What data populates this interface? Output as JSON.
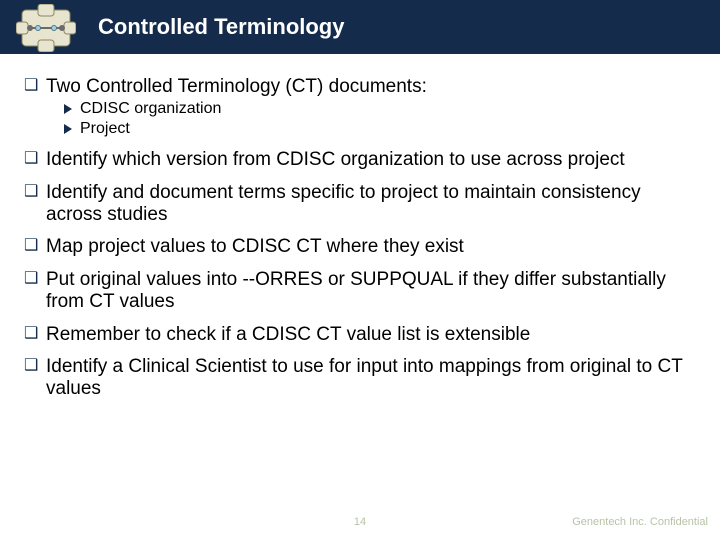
{
  "title": "Controlled Terminology",
  "bullets": [
    {
      "text": "Two Controlled Terminology (CT) documents:",
      "children": [
        {
          "text": "CDISC organization"
        },
        {
          "text": "Project"
        }
      ]
    },
    {
      "text": "Identify which version from CDISC organization to use across project"
    },
    {
      "text": "Identify and document terms specific to project to maintain consistency across studies"
    },
    {
      "text": "Map project values to CDISC CT where they exist"
    },
    {
      "text": "Put original values into --ORRES or SUPPQUAL if they differ substantially from CT values"
    },
    {
      "text": "Remember to check if a CDISC CT value list is extensible"
    },
    {
      "text": "Identify a Clinical Scientist to use for input into mappings from original to CT values"
    }
  ],
  "footer": {
    "page": "14",
    "confidential": "Genentech Inc. Confidential"
  },
  "colors": {
    "titlebar": "#152b4b",
    "footer_text": "#b7c3a7"
  }
}
